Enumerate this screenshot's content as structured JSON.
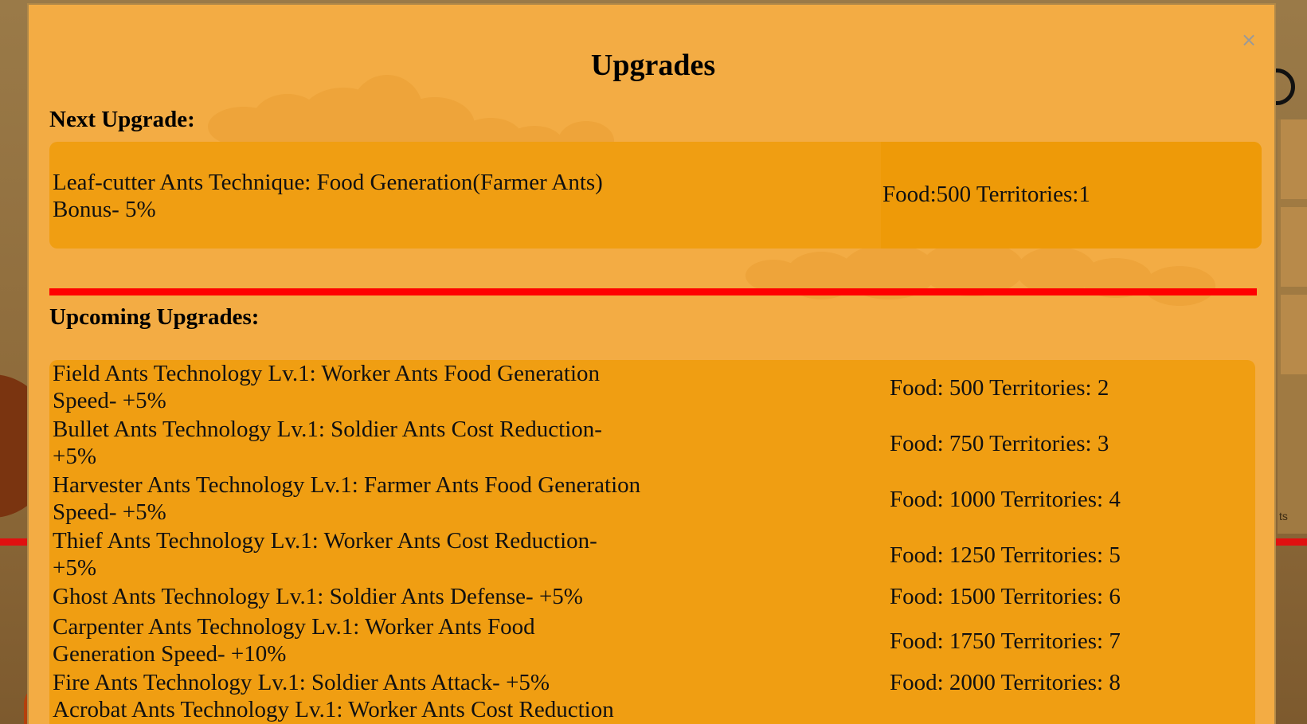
{
  "modal": {
    "title": "Upgrades",
    "close_glyph": "×"
  },
  "next_upgrade": {
    "heading": "Next Upgrade:",
    "description": "Leaf-cutter Ants Technique: Food Generation(Farmer Ants) Bonus- 5%",
    "cost": "Food:500 Territories:1"
  },
  "upcoming": {
    "heading": "Upcoming Upgrades:",
    "items": [
      {
        "description": "Field Ants Technology Lv.1: Worker Ants Food Generation Speed- +5%",
        "cost": "Food: 500 Territories: 2"
      },
      {
        "description": "Bullet Ants Technology Lv.1: Soldier Ants Cost Reduction- +5%",
        "cost": "Food: 750 Territories: 3"
      },
      {
        "description": "Harvester Ants Technology Lv.1: Farmer Ants Food Generation Speed- +5%",
        "cost": "Food: 1000 Territories: 4"
      },
      {
        "description": "Thief Ants Technology Lv.1: Worker Ants Cost Reduction- +5%",
        "cost": "Food: 1250 Territories: 5"
      },
      {
        "description": "Ghost Ants Technology Lv.1: Soldier Ants Defense- +5%",
        "cost": "Food: 1500 Territories: 6"
      },
      {
        "description": "Carpenter Ants Technology Lv.1: Worker Ants Food Generation Speed- +10%",
        "cost": "Food: 1750 Territories: 7"
      },
      {
        "description": "Fire Ants Technology Lv.1: Soldier Ants Attack- +5%",
        "cost": "Food: 2000 Territories: 8"
      },
      {
        "description": "Acrobat Ants Technology Lv.1: Worker Ants Cost Reduction",
        "cost": ""
      }
    ]
  },
  "background": {
    "side_text": "ts"
  },
  "colors": {
    "modal_bg": "#f3ac44",
    "card_bg": "#f09e12",
    "divider": "#ff0000",
    "text": "#111111"
  }
}
